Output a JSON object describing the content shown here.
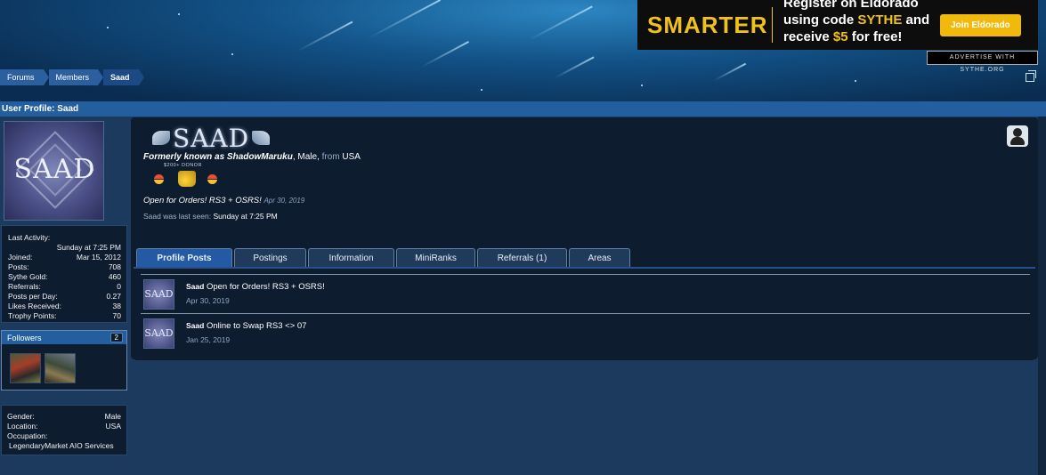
{
  "ad": {
    "brand": "SMARTER",
    "line1": "Register on Eldorado",
    "line2_pre": "using code ",
    "line2_code": "SYTHE",
    "line2_post": " and",
    "line3_pre": "receive ",
    "line3_amount": "$5",
    "line3_post": " for free!",
    "button": "Join Eldorado",
    "advertise": "ADVERTISE WITH SYTHE.ORG"
  },
  "breadcrumb": [
    "Forums",
    "Members",
    "Saad"
  ],
  "page_title": "User Profile: Saad",
  "avatar_text": "SAAD",
  "stats": {
    "last_activity_label": "Last Activity:",
    "last_activity_value": "Sunday at 7:25 PM",
    "rows": [
      {
        "label": "Joined:",
        "value": "Mar 15, 2012"
      },
      {
        "label": "Posts:",
        "value": "708"
      },
      {
        "label": "Sythe Gold:",
        "value": "460"
      },
      {
        "label": "Referrals:",
        "value": "0"
      },
      {
        "label": "Posts per Day:",
        "value": "0.27"
      },
      {
        "label": "Likes Received:",
        "value": "38"
      },
      {
        "label": "Trophy Points:",
        "value": "70"
      }
    ]
  },
  "followers": {
    "label": "Followers",
    "count": "2"
  },
  "about": {
    "gender_label": "Gender:",
    "gender": "Male",
    "location_label": "Location:",
    "location": "USA",
    "occupation_label": "Occupation:",
    "occupation": "LegendaryMarket AIO Services"
  },
  "profile": {
    "username": "SAAD",
    "formerly": "Formerly known as ShadowMaruku",
    "gender": ", Male, ",
    "from": "from",
    "location": " USA",
    "donor": "$200+ DONOR",
    "status": "Open for Orders! RS3 + OSRS!",
    "status_date": "Apr 30, 2019",
    "last_seen_label": "Saad was last seen:",
    "last_seen": "Sunday at 7:25 PM"
  },
  "tabs": [
    "Profile Posts",
    "Postings",
    "Information",
    "MiniRanks",
    "Referrals (1)",
    "Areas"
  ],
  "posts": [
    {
      "author": "Saad",
      "text": " Open for Orders! RS3 + OSRS!",
      "date": "Apr 30, 2019",
      "avatar": "SAAD"
    },
    {
      "author": "Saad",
      "text": " Online to Swap RS3 <> 07",
      "date": "Jan 25, 2019",
      "avatar": "SAAD"
    }
  ]
}
